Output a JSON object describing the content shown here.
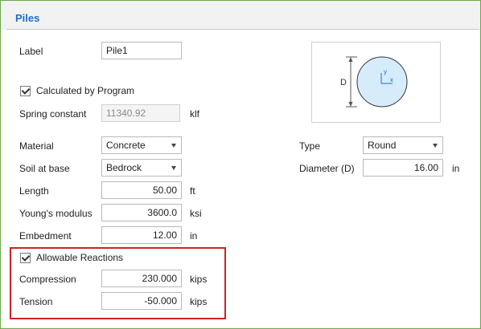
{
  "section": {
    "title": "Piles"
  },
  "label": {
    "caption": "Label",
    "value": "Pile1"
  },
  "calc_by_program": {
    "caption": "Calculated by Program",
    "checked": true
  },
  "spring_constant": {
    "caption": "Spring constant",
    "value": "11340.92",
    "unit": "klf"
  },
  "material": {
    "caption": "Material",
    "value": "Concrete"
  },
  "soil_at_base": {
    "caption": "Soil at base",
    "value": "Bedrock"
  },
  "length": {
    "caption": "Length",
    "value": "50.00",
    "unit": "ft"
  },
  "youngs_modulus": {
    "caption": "Young's modulus",
    "value": "3600.0",
    "unit": "ksi"
  },
  "embedment": {
    "caption": "Embedment",
    "value": "12.00",
    "unit": "in"
  },
  "allowable_reactions": {
    "caption": "Allowable Reactions",
    "checked": true
  },
  "compression": {
    "caption": "Compression",
    "value": "230.000",
    "unit": "kips"
  },
  "tension": {
    "caption": "Tension",
    "value": "-50.000",
    "unit": "kips"
  },
  "type": {
    "caption": "Type",
    "value": "Round"
  },
  "diameter": {
    "caption": "Diameter (D)",
    "value": "16.00",
    "unit": "in"
  },
  "section_diagram": {
    "dimension_label": "D",
    "axis_y": "y",
    "axis_x": "x"
  },
  "colors": {
    "accent": "#1a6fc4",
    "highlight_border": "#d42020",
    "frame_border": "#6aa84f",
    "circle_fill": "#d6ecfb"
  }
}
